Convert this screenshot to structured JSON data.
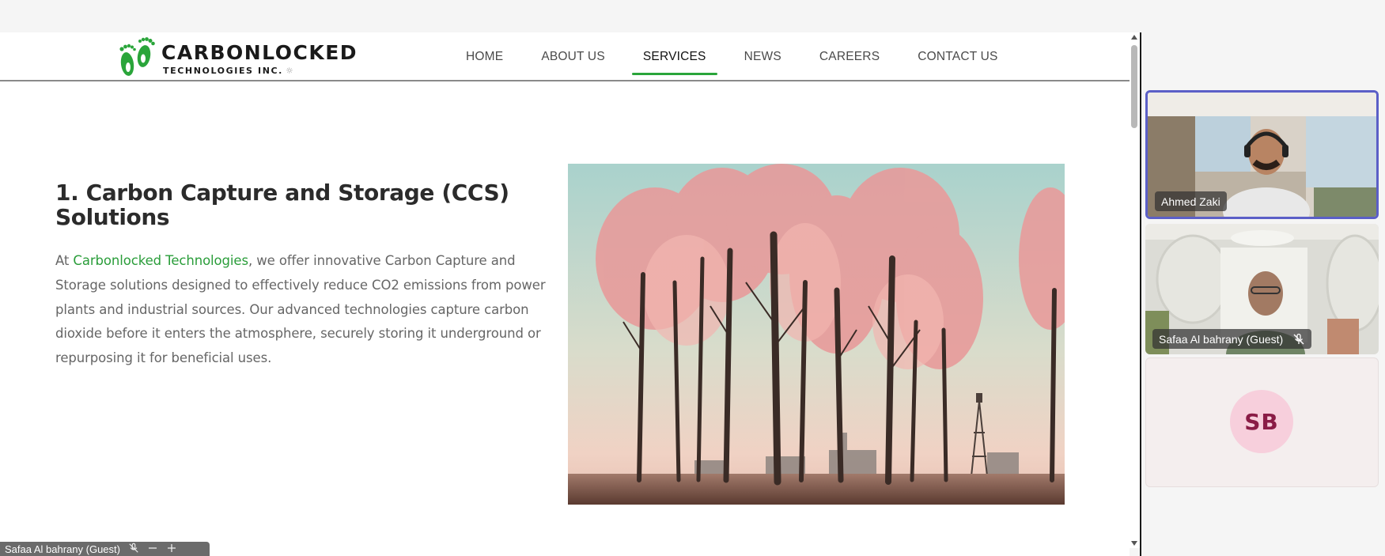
{
  "site": {
    "logo": {
      "main": "CARBONLOCKED",
      "sub": "TECHNOLOGIES INC.",
      "sub_icon": "☼"
    },
    "nav": [
      {
        "label": "HOME",
        "active": false
      },
      {
        "label": "ABOUT US",
        "active": false
      },
      {
        "label": "SERVICES",
        "active": true
      },
      {
        "label": "NEWS",
        "active": false
      },
      {
        "label": "CAREERS",
        "active": false
      },
      {
        "label": "CONTACT US",
        "active": false
      }
    ],
    "accent_color": "#2aa53a"
  },
  "content": {
    "title": "1. Carbon Capture and Storage (CCS) Solutions",
    "body_prefix": "At ",
    "body_link": "Carbonlocked Technologies",
    "body_rest": ", we offer innovative Carbon Capture and Storage solutions designed to effectively reduce CO2 emissions from power plants and industrial sources. Our advanced technologies capture carbon dioxide before it enters the atmosphere, securely storing it underground or repurposing it for beneficial uses."
  },
  "meeting": {
    "participants": [
      {
        "name": "Ahmed Zaki",
        "speaking": true,
        "muted": false
      },
      {
        "name": "Safaa Al bahrany (Guest)",
        "speaking": false,
        "muted": true
      },
      {
        "initials": "SB"
      }
    ],
    "mini_bar": {
      "name": "Safaa Al bahrany (Guest)"
    },
    "speaker_highlight_color": "#5b5fc7"
  }
}
